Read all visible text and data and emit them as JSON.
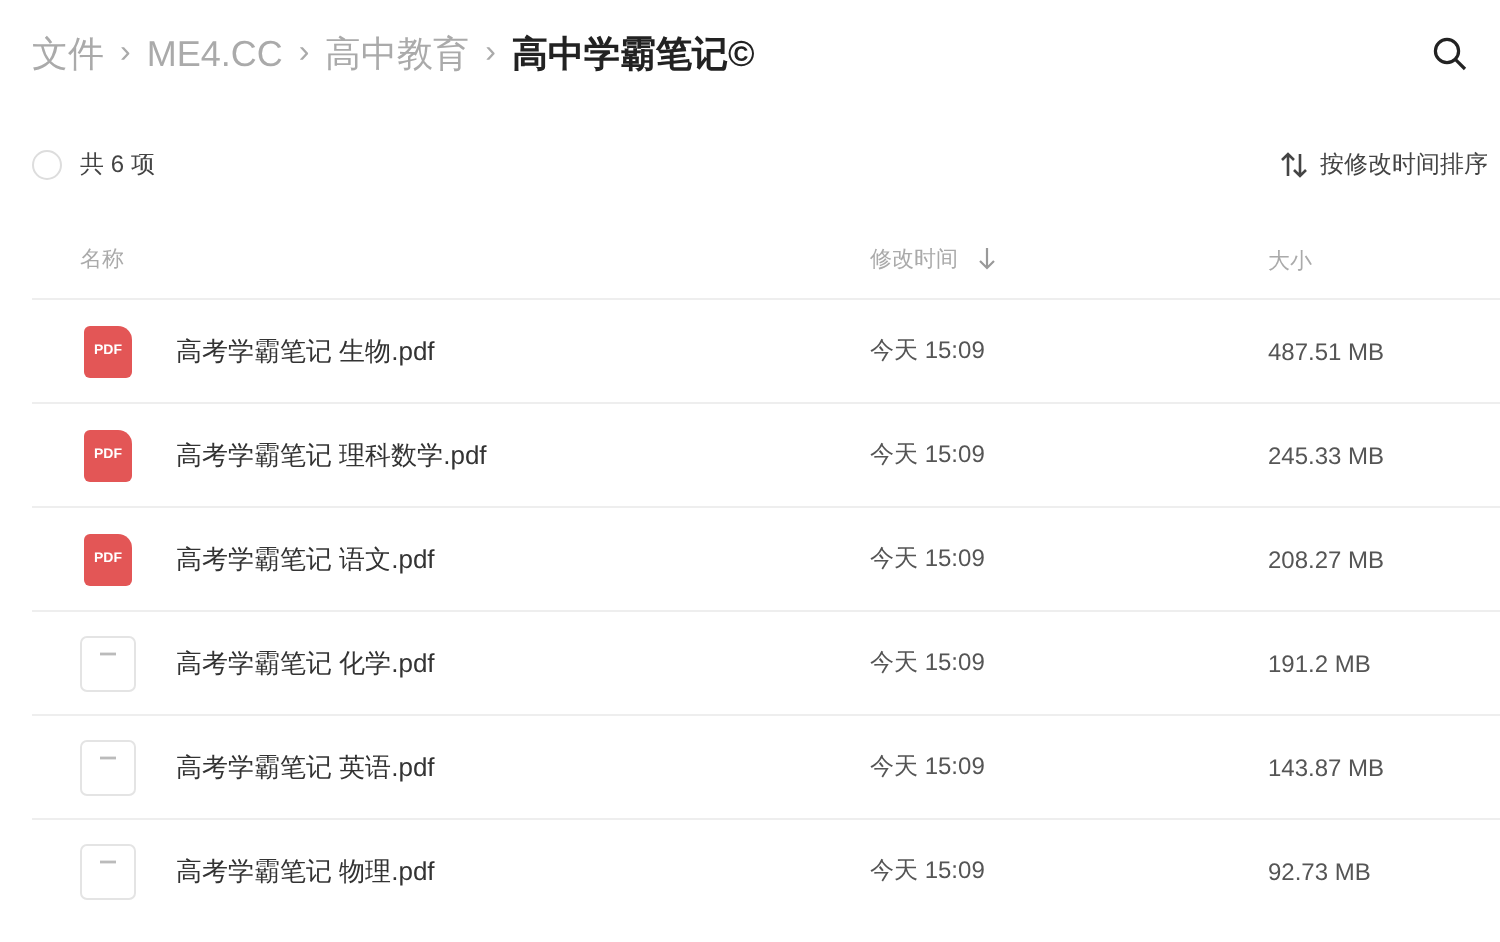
{
  "breadcrumb": {
    "separator": "›",
    "items": [
      {
        "label": "文件",
        "current": false
      },
      {
        "label": "ME4.CC",
        "current": false
      },
      {
        "label": "高中教育",
        "current": false
      },
      {
        "label": "高中学霸笔记©",
        "current": true
      }
    ]
  },
  "toolbar": {
    "select_all": {
      "checked": false
    },
    "count": "共 6 项",
    "sort_button": "按修改时间排序"
  },
  "table": {
    "columns": [
      "名称",
      "修改时间",
      "大小"
    ],
    "rows": [
      {
        "kind": "pdf",
        "icon_text": "PDF",
        "name": "高考学霸笔记 生物.pdf",
        "modified": "今天 15:09",
        "size": "487.51 MB"
      },
      {
        "kind": "pdf",
        "icon_text": "PDF",
        "name": "高考学霸笔记 理科数学.pdf",
        "modified": "今天 15:09",
        "size": "245.33 MB"
      },
      {
        "kind": "pdf",
        "icon_text": "PDF",
        "name": "高考学霸笔记 语文.pdf",
        "modified": "今天 15:09",
        "size": "208.27 MB"
      },
      {
        "kind": "thumbnail",
        "name": "高考学霸笔记 化学.pdf",
        "modified": "今天 15:09",
        "size": "191.2 MB"
      },
      {
        "kind": "thumbnail",
        "name": "高考学霸笔记 英语.pdf",
        "modified": "今天 15:09",
        "size": "143.87 MB"
      },
      {
        "kind": "thumbnail",
        "name": "高考学霸笔记 物理.pdf",
        "modified": "今天 15:09",
        "size": "92.73 MB"
      }
    ]
  }
}
